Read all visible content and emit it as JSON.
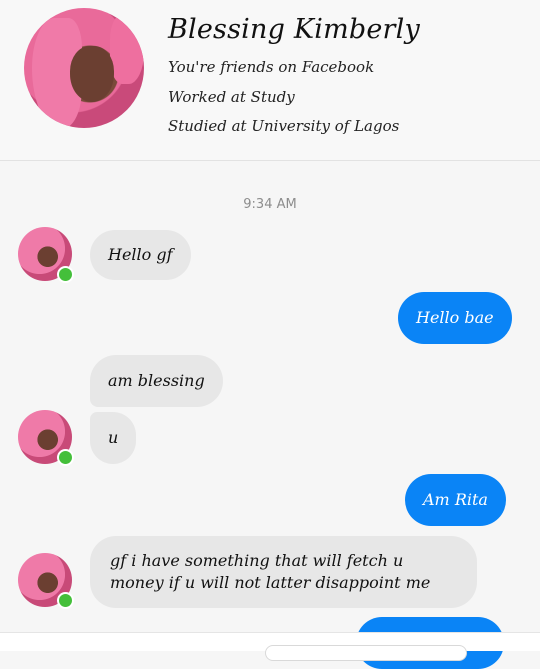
{
  "profile": {
    "name": "Blessing Kimberly",
    "lines": [
      "You're friends on Facebook",
      "Worked at Study",
      "Studied at University of Lagos"
    ]
  },
  "conversation": {
    "timestamp": "9:34 AM",
    "messages": [
      {
        "direction": "in",
        "text": "Hello gf"
      },
      {
        "direction": "out",
        "text": "Hello bae"
      },
      {
        "direction": "in",
        "text": "am blessing"
      },
      {
        "direction": "in",
        "text": "u"
      },
      {
        "direction": "out",
        "text": "Am Rita"
      },
      {
        "direction": "in",
        "text": "gf i have something that will fetch u money if u will not latter disappoint me"
      },
      {
        "direction": "out",
        "text": ""
      }
    ]
  },
  "colors": {
    "outgoing_bubble": "#0a84f6",
    "incoming_bubble": "#e7e7e7",
    "online_indicator": "#44bf3a"
  }
}
